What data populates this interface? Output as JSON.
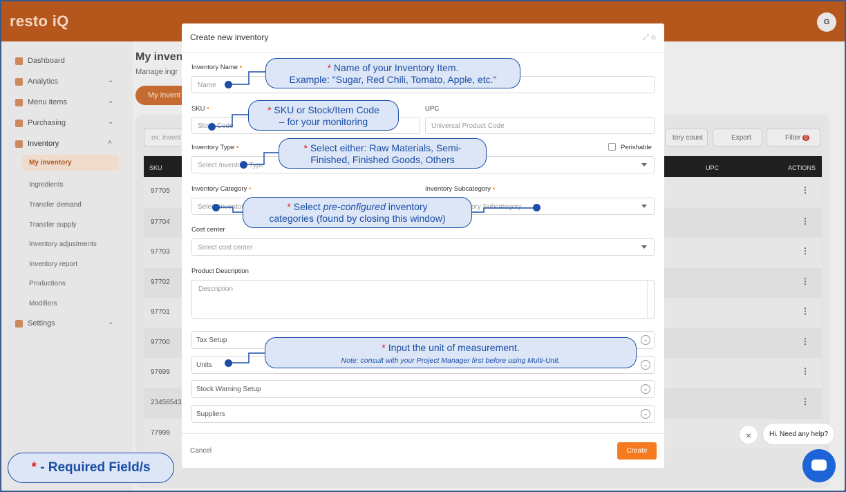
{
  "app": {
    "logo": "resto iQ",
    "avatar_initial": "G"
  },
  "sidebar": {
    "items": [
      {
        "label": "Dashboard"
      },
      {
        "label": "Analytics"
      },
      {
        "label": "Menu items"
      },
      {
        "label": "Purchasing"
      },
      {
        "label": "Inventory"
      },
      {
        "label": "Settings"
      }
    ],
    "inventory_sub": [
      "My inventory",
      "Ingredients",
      "Transfer demand",
      "Transfer supply",
      "Inventory adjustments",
      "Inventory report",
      "Productions",
      "Modifiers"
    ]
  },
  "background": {
    "title": "My invent",
    "subtitle": "Manage ingr",
    "pill": "My invent",
    "search_placeholder": "ex: invent",
    "inventory_count_btn": "tory count",
    "export_btn": "Export",
    "filter_btn": "Filter",
    "filter_count": "0",
    "columns": {
      "sku": "SKU",
      "upc": "UPC",
      "actions": "ACTIONS"
    },
    "rows": [
      "97705",
      "97704",
      "97703",
      "97702",
      "97701",
      "97700",
      "97699",
      "23456543",
      "77998"
    ]
  },
  "modal": {
    "title": "Create new inventory",
    "fields": {
      "name": {
        "label": "Inventory Name",
        "placeholder": "Name"
      },
      "sku": {
        "label": "SKU",
        "placeholder": "Stock Code"
      },
      "upc": {
        "label": "UPC",
        "placeholder": "Universal Product Code"
      },
      "type": {
        "label": "Inventory Type",
        "placeholder": "Select Inventory Type"
      },
      "perishable": {
        "label": "Perishable"
      },
      "category": {
        "label": "Inventory Category",
        "placeholder": "Select Inventory Category"
      },
      "subcategory": {
        "label": "Inventory Subcategory",
        "placeholder": "Select Inventory Subcategory"
      },
      "cost_center": {
        "label": "Cost center",
        "placeholder": "Select cost center"
      },
      "description": {
        "label": "Product Description",
        "placeholder": "Description"
      }
    },
    "accordions": [
      "Tax Setup",
      "Units",
      "Stock Warning Setup",
      "Suppliers"
    ],
    "cancel": "Cancel",
    "create": "Create"
  },
  "callouts": {
    "name": {
      "line1": "Name of your Inventory Item.",
      "line2": "Example: \"Sugar, Red Chili, Tomato, Apple, etc.\""
    },
    "sku": {
      "line1": "SKU or Stock/Item Code",
      "line2": "– for your monitoring"
    },
    "type": {
      "line1": "Select either: Raw Materials, Semi-",
      "line2": "Finished, Finished Goods, Others"
    },
    "category": {
      "line1_pre": "Select ",
      "line1_em": "pre-configured",
      "line1_post": " inventory",
      "line2": "categories (found by closing this window)"
    },
    "units": {
      "line1": "Input the unit of measurement.",
      "note": "Note: consult with your Project Manager first before using Multi-Unit."
    },
    "star": "*"
  },
  "legend": {
    "star": "*",
    "text": " - Required Field/s"
  },
  "chat": {
    "bubble": "Hi. Need any help?",
    "close": "×"
  }
}
